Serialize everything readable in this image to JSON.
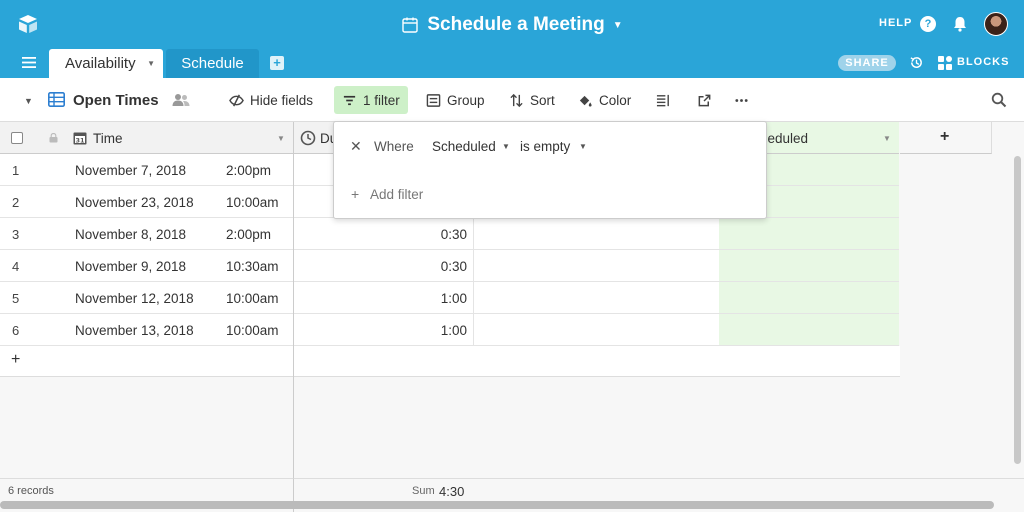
{
  "topbar": {
    "base_title": "Schedule a Meeting",
    "help_label": "HELP",
    "help_q": "?",
    "accent": "#2aa5d8"
  },
  "tabs": {
    "active": "Availability",
    "other": "Schedule",
    "share_label": "SHARE",
    "blocks_label": "BLOCKS"
  },
  "toolbar": {
    "view_name": "Open Times",
    "hide_fields": "Hide fields",
    "filter": "1 filter",
    "group": "Group",
    "sort": "Sort",
    "color": "Color"
  },
  "grid": {
    "col_time": "Time",
    "col_duration_partial": "Du",
    "col_scheduled_partial": "heduled",
    "add_field": "+",
    "rows": [
      {
        "num": "1",
        "date": "November 7, 2018",
        "time": "2:00pm",
        "duration": ""
      },
      {
        "num": "2",
        "date": "November 23, 2018",
        "time": "10:00am",
        "duration": ""
      },
      {
        "num": "3",
        "date": "November 8, 2018",
        "time": "2:00pm",
        "duration": "0:30"
      },
      {
        "num": "4",
        "date": "November 9, 2018",
        "time": "10:30am",
        "duration": "0:30"
      },
      {
        "num": "5",
        "date": "November 12, 2018",
        "time": "10:00am",
        "duration": "1:00"
      },
      {
        "num": "6",
        "date": "November 13, 2018",
        "time": "10:00am",
        "duration": "1:00"
      }
    ],
    "add_row": "+"
  },
  "footer": {
    "records": "6 records",
    "sum_label": "Sum",
    "sum_value": "4:30"
  },
  "filter_popover": {
    "close": "✕",
    "where": "Where",
    "field": "Scheduled",
    "operator": "is empty",
    "add_plus": "+",
    "add_filter": "Add filter"
  }
}
